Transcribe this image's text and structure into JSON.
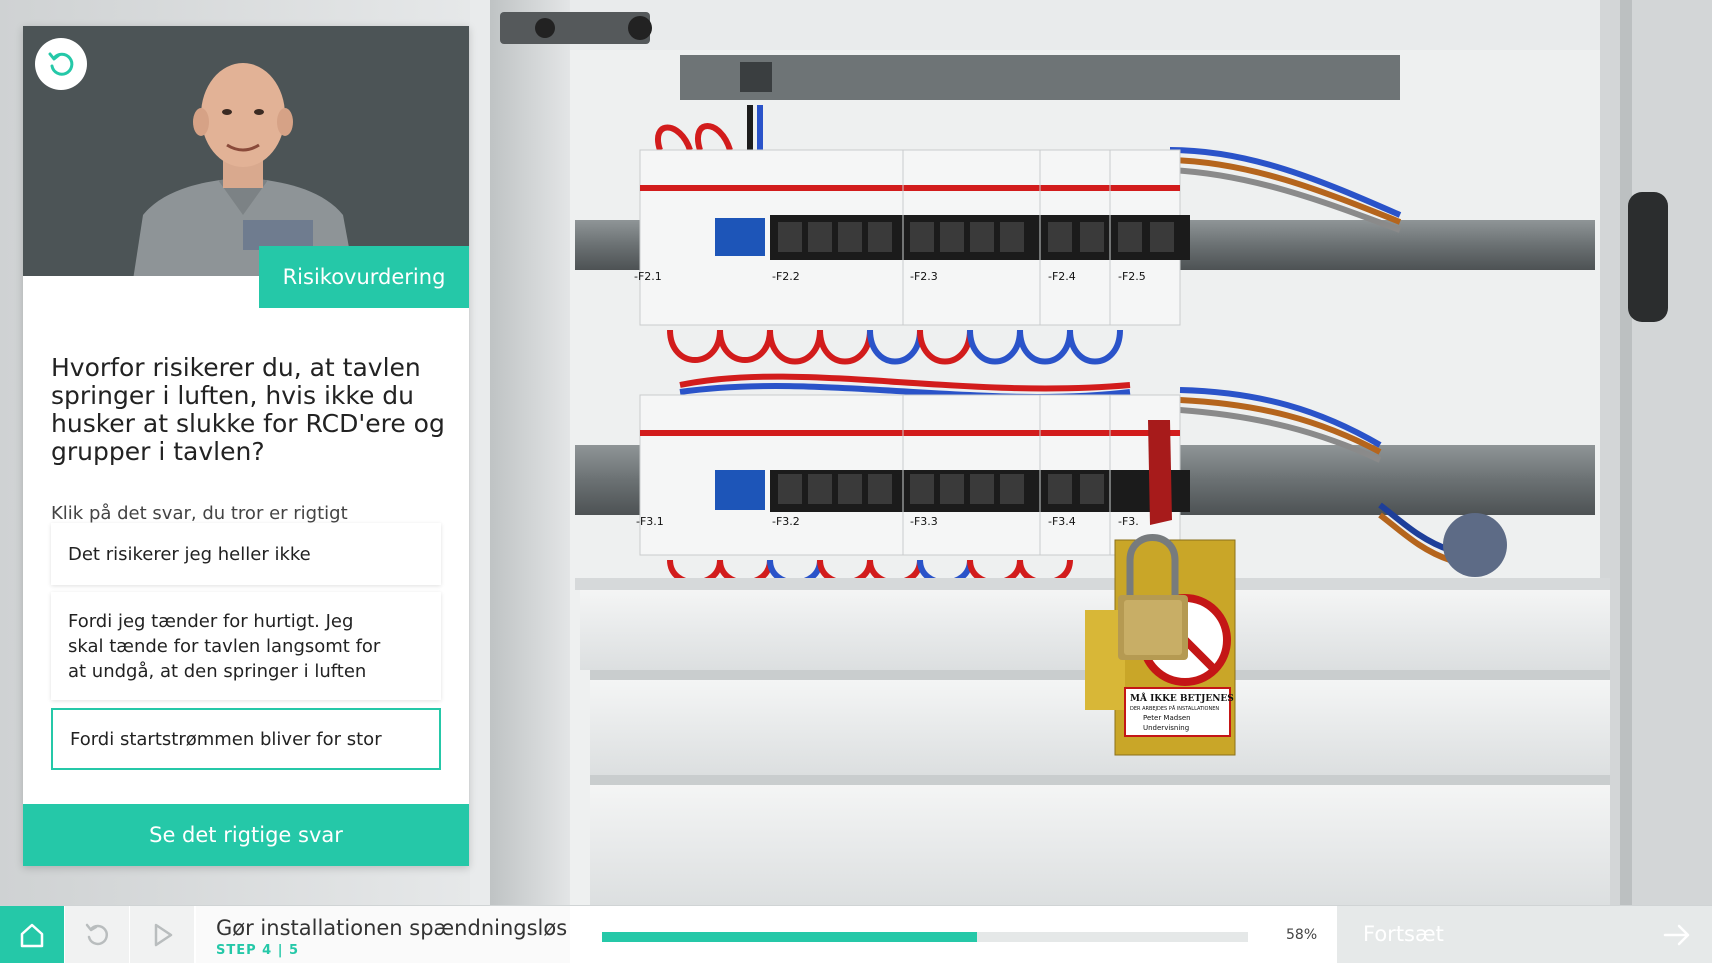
{
  "panel": {
    "topic_badge": "Risikovurdering",
    "question": "Hvorfor risikerer du, at tavlen springer i luften, hvis ikke du husker at slukke for RCD'ere og grupper i tavlen?",
    "hint": "Klik på det svar, du tror er rigtigt",
    "answers": [
      {
        "text": "Det risikerer jeg heller ikke"
      },
      {
        "text": "Fordi jeg tænder for hurtigt. Jeg skal tænde for tavlen langsomt for at undgå, at den springer i luften"
      },
      {
        "text": "Fordi startstrømmen bliver for stor"
      }
    ],
    "show_answer_label": "Se det rigtige svar"
  },
  "scene": {
    "row1_labels": [
      "-F2.1",
      "-F2.2",
      "-F2.3",
      "-F2.4",
      "-F2.5"
    ],
    "row2_labels": [
      "-F3.1",
      "-F3.2",
      "-F3.3",
      "-F3.4",
      "-F3."
    ],
    "tag_title": "MÅ IKKE BETJENES",
    "tag_subtitle": "DER ARBEJDES PÅ INSTALLATIONEN",
    "tag_name": "Peter Madsen",
    "tag_purpose": "Undervisning"
  },
  "bottombar": {
    "step_title": "Gør installationen spændningsløs",
    "step_label": "STEP 4 | 5",
    "progress_value": 58,
    "progress_text": "58%",
    "continue_label": "Fortsæt"
  },
  "colors": {
    "accent": "#25c8a8",
    "panel_bg": "#ffffff",
    "video_bg": "#4c5456"
  },
  "icons": {
    "replay": "replay-icon",
    "home": "home-icon",
    "restart": "restart-icon",
    "play": "play-icon",
    "continue": "arrow-right-icon"
  }
}
